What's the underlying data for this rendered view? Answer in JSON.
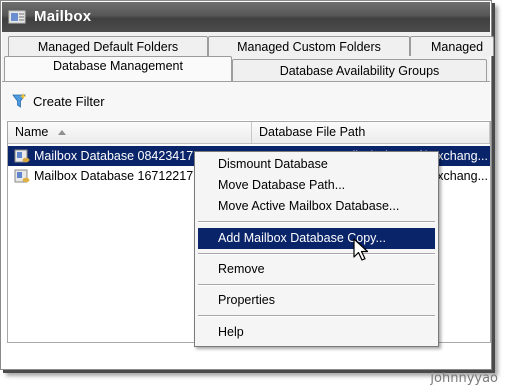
{
  "window": {
    "title": "Mailbox",
    "icon": "mailbox-icon"
  },
  "tabs": {
    "row1": [
      "Managed Default Folders",
      "Managed Custom Folders",
      "Managed"
    ],
    "row2": [
      "Database Management",
      "Database Availability Groups"
    ],
    "active": "Database Management"
  },
  "toolbar": {
    "create_filter": "Create Filter",
    "icon": "filter-icon"
  },
  "table": {
    "columns": [
      "Name",
      "Database File Path"
    ],
    "rows": [
      {
        "name": "Mailbox Database 08423417",
        "path": "...Files\\Microsoft\\Exchang...",
        "selected": true
      },
      {
        "name": "Mailbox Database 16712217",
        "path": "...Files\\Microsoft\\Exchang...",
        "selected": false
      }
    ]
  },
  "context_menu": {
    "items": [
      "Dismount Database",
      "Move Database Path...",
      "Move Active Mailbox Database...",
      "Add Mailbox Database Copy...",
      "Remove",
      "Properties",
      "Help"
    ],
    "highlighted": "Add Mailbox Database Copy..."
  },
  "watermark": "johnnyyao",
  "colors": {
    "selection": "#0a246a",
    "titlebar": "#505050"
  }
}
